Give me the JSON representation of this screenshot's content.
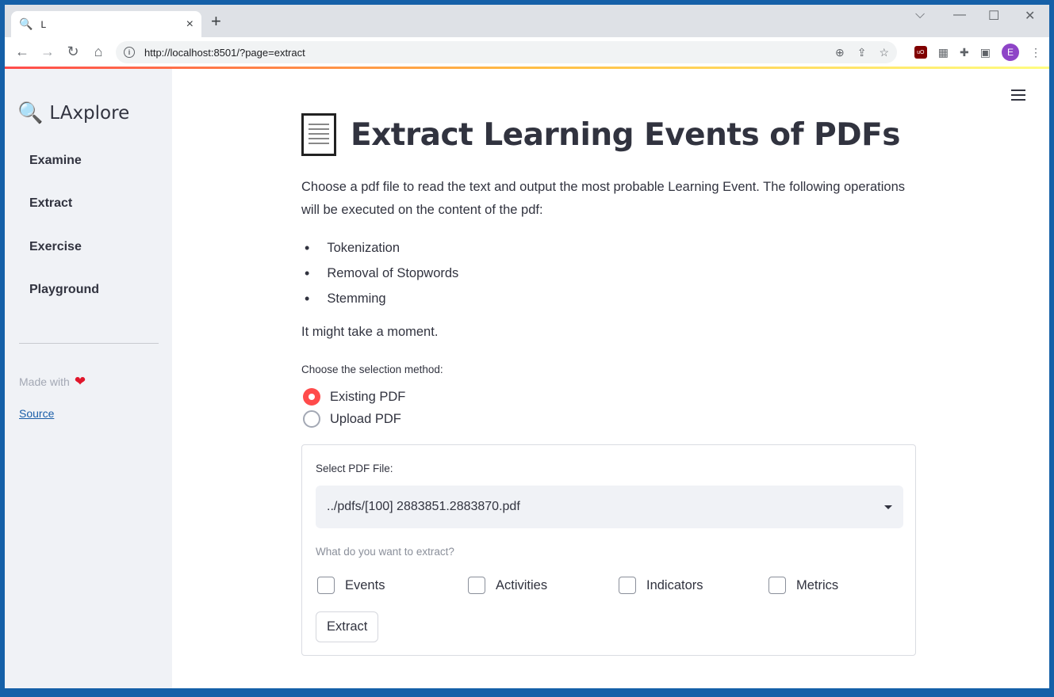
{
  "browser": {
    "tab_title": "L",
    "tab_favicon": "🔍",
    "new_tab": "+",
    "close_tab": "×",
    "url": "http://localhost:8501/?page=extract",
    "profile_initial": "E",
    "ublock_badge": "uO"
  },
  "sidebar": {
    "brand_icon": "🔍",
    "brand_title": "LAxplore",
    "items": [
      {
        "label": "Examine"
      },
      {
        "label": "Extract"
      },
      {
        "label": "Exercise"
      },
      {
        "label": "Playground"
      }
    ],
    "made_with": "Made with",
    "heart": "❤",
    "source_link": "Source"
  },
  "main": {
    "title": "Extract Learning Events of PDFs",
    "intro": "Choose a pdf file to read the text and output the most probable Learning Event. The following operations will be executed on the content of the pdf:",
    "operations": [
      "Tokenization",
      "Removal of Stopwords",
      "Stemming"
    ],
    "moment_note": "It might take a moment.",
    "selection_label": "Choose the selection method:",
    "radio_options": [
      {
        "label": "Existing PDF",
        "selected": true
      },
      {
        "label": "Upload PDF",
        "selected": false
      }
    ],
    "form": {
      "select_label": "Select PDF File:",
      "select_value": "../pdfs/[100] 2883851.2883870.pdf",
      "extract_question": "What do you want to extract?",
      "checkboxes": [
        {
          "label": "Events",
          "checked": false
        },
        {
          "label": "Activities",
          "checked": false
        },
        {
          "label": "Indicators",
          "checked": false
        },
        {
          "label": "Metrics",
          "checked": false
        }
      ],
      "submit_label": "Extract"
    }
  },
  "colors": {
    "accent": "#ff4b4b",
    "sidebar_bg": "#f0f2f6",
    "text": "#31333f",
    "link": "#1a5ea8",
    "desktop_frame": "#1560a8"
  }
}
